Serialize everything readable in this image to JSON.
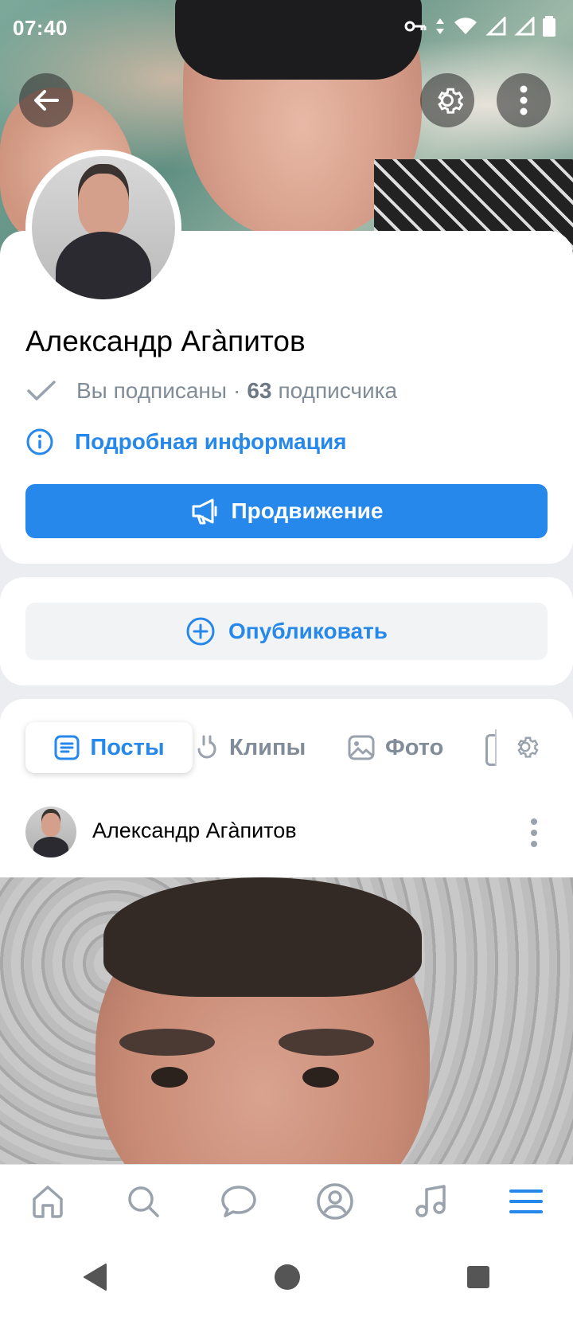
{
  "status_bar": {
    "time": "07:40"
  },
  "profile": {
    "name": "Александр Агàпитов",
    "subscribed_label": "Вы подписаны",
    "separator": "·",
    "followers_count": "63",
    "followers_label": "подписчика",
    "details_link": "Подробная информация",
    "promote_button": "Продвижение"
  },
  "publish": {
    "button_label": "Опубликовать"
  },
  "tabs": [
    {
      "label": "Посты",
      "active": true
    },
    {
      "label": "Клипы",
      "active": false
    },
    {
      "label": "Фото",
      "active": false
    }
  ],
  "post": {
    "author": "Александр Агàпитов"
  },
  "colors": {
    "accent": "#2688eb",
    "muted": "#818c99",
    "background": "#ebedf0"
  }
}
